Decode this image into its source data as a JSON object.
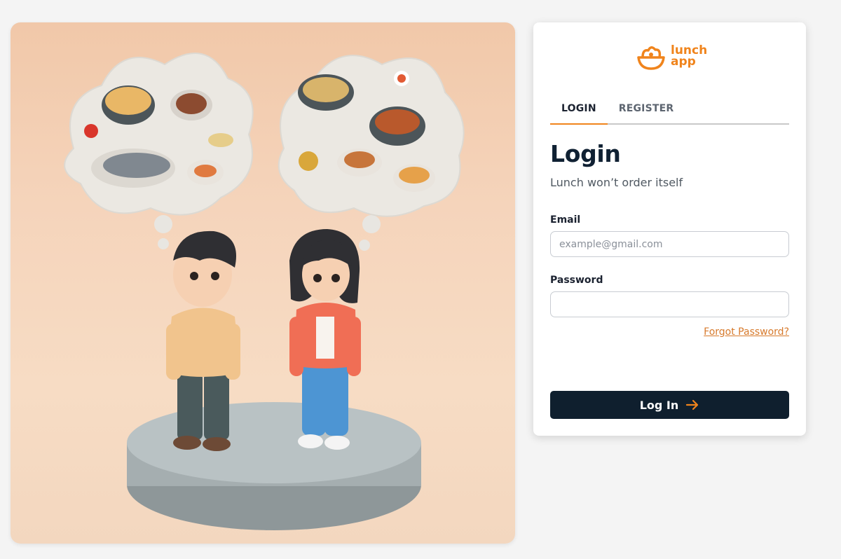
{
  "hero": {
    "image_description": "",
    "accent_color": "#f0841c"
  },
  "brand": {
    "line1": "lunch",
    "line2": "app",
    "color": "#f0841c",
    "icon": "bowl-icon"
  },
  "tabs": [
    {
      "label": "LOGIN",
      "active": true
    },
    {
      "label": "REGISTER",
      "active": false
    }
  ],
  "form": {
    "title": "Login",
    "subtitle": "Lunch won’t order itself",
    "email_label": "Email",
    "email_placeholder": "example@gmail.com",
    "email_value": "",
    "password_label": "Password",
    "password_value": "",
    "forgot_label": "Forgot Password?",
    "submit_label": "Log In",
    "submit_icon": "arrow-right-icon"
  },
  "colors": {
    "accent": "#f0841c",
    "button_bg": "#0f1f2e",
    "title": "#102133"
  }
}
